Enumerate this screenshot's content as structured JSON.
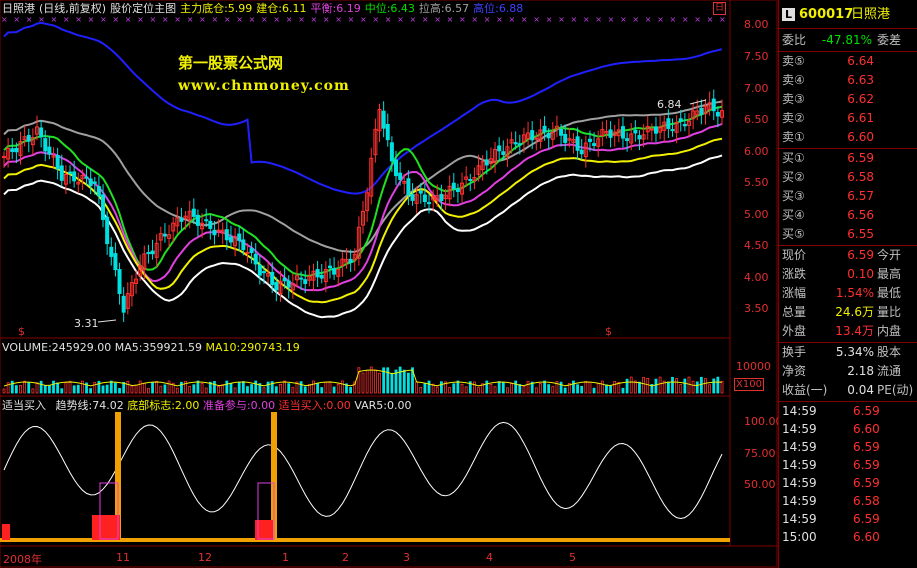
{
  "header": {
    "name": "日照港",
    "mode": "(日线,前复权)",
    "chart_title": "股价定位主图",
    "items": [
      {
        "label": "主力底仓:5.99",
        "color": "#f0f000"
      },
      {
        "label": "建仓:6.11",
        "color": "#f0f000"
      },
      {
        "label": "平衡:6.19",
        "color": "#e040e0"
      },
      {
        "label": "中位:6.43",
        "color": "#00e000"
      },
      {
        "label": "拉高:6.57",
        "color": "#a0a0a0"
      },
      {
        "label": "高位:6.88",
        "color": "#4040ff"
      }
    ],
    "close_box": "日"
  },
  "watermark": {
    "line1": "第一股票公式网",
    "line2": "www.chnmoney.com"
  },
  "price_axis": [
    "8.00",
    "7.50",
    "7.00",
    "6.50",
    "6.00",
    "5.50",
    "5.00",
    "4.50",
    "4.00",
    "3.50"
  ],
  "annotations": {
    "high": "6.84",
    "low": "3.31"
  },
  "volume": {
    "label": "VOLUME:245929.00",
    "ma5": "MA5:359921.59",
    "ma10": "MA10:290743.19",
    "axis": "10000",
    "unit": "X100"
  },
  "indicator": {
    "name": "适当买入",
    "items": [
      {
        "label": "趋势线:74.02",
        "color": "#e0e0e0"
      },
      {
        "label": "底部标志:2.00",
        "color": "#f0f000"
      },
      {
        "label": "准备参与:0.00",
        "color": "#e040e0"
      },
      {
        "label": "适当买入:0.00",
        "color": "#ff3030"
      },
      {
        "label": "VAR5:0.00",
        "color": "#e0e0e0"
      }
    ],
    "axis": [
      "100.00",
      "75.00",
      "50.00"
    ]
  },
  "dates": [
    "2008年",
    "11",
    "12",
    "1",
    "2",
    "3",
    "4",
    "5"
  ],
  "panel": {
    "code": "600017",
    "name": "日照港",
    "badge": "L",
    "weibi_label": "委比",
    "weibi_value": "-47.81%",
    "weicha_label": "委差",
    "sells": [
      {
        "label": "卖⑤",
        "price": "6.64"
      },
      {
        "label": "卖④",
        "price": "6.63"
      },
      {
        "label": "卖③",
        "price": "6.62"
      },
      {
        "label": "卖②",
        "price": "6.61"
      },
      {
        "label": "卖①",
        "price": "6.60"
      }
    ],
    "buys": [
      {
        "label": "买①",
        "price": "6.59"
      },
      {
        "label": "买②",
        "price": "6.58"
      },
      {
        "label": "买③",
        "price": "6.57"
      },
      {
        "label": "买④",
        "price": "6.56"
      },
      {
        "label": "买⑤",
        "price": "6.55"
      }
    ],
    "stats": [
      {
        "k": "现价",
        "v": "6.59",
        "k2": "今开",
        "color": "#ff3030"
      },
      {
        "k": "涨跌",
        "v": "0.10",
        "k2": "最高",
        "color": "#ff3030"
      },
      {
        "k": "涨幅",
        "v": "1.54%",
        "k2": "最低",
        "color": "#ff3030"
      },
      {
        "k": "总量",
        "v": "24.6万",
        "k2": "量比",
        "color": "#f0f000"
      },
      {
        "k": "外盘",
        "v": "13.4万",
        "k2": "内盘",
        "color": "#ff3030"
      }
    ],
    "stats2": [
      {
        "k": "换手",
        "v": "5.34%",
        "k2": "股本",
        "color": "#e0e0e0"
      },
      {
        "k": "净资",
        "v": "2.18",
        "k2": "流通",
        "color": "#e0e0e0"
      },
      {
        "k": "收益(一)",
        "v": "0.04",
        "k2": "PE(动)",
        "color": "#e0e0e0"
      }
    ],
    "ticks": [
      {
        "t": "14:59",
        "p": "6.59"
      },
      {
        "t": "14:59",
        "p": "6.60"
      },
      {
        "t": "14:59",
        "p": "6.59"
      },
      {
        "t": "14:59",
        "p": "6.59"
      },
      {
        "t": "14:59",
        "p": "6.59"
      },
      {
        "t": "14:59",
        "p": "6.58"
      },
      {
        "t": "14:59",
        "p": "6.59"
      },
      {
        "t": "15:00",
        "p": "6.60"
      }
    ]
  }
}
